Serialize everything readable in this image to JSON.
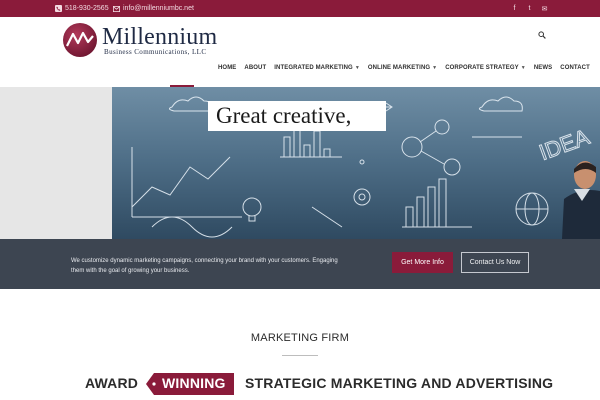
{
  "topbar": {
    "phone": "518-930-2565",
    "email": "info@millenniumbc.net",
    "social": [
      {
        "icon": "facebook-icon",
        "glyph": "f"
      },
      {
        "icon": "twitter-icon",
        "glyph": "t"
      },
      {
        "icon": "mail-icon",
        "glyph": "✉"
      }
    ]
  },
  "brand": {
    "name": "Millennium",
    "subtitle": "Business Communications, LLC",
    "accent": "#8a1b3a",
    "navy": "#1f2a44"
  },
  "nav": {
    "items": [
      {
        "label": "HOME",
        "dropdown": false
      },
      {
        "label": "ABOUT",
        "dropdown": false
      },
      {
        "label": "INTEGRATED MARKETING",
        "dropdown": true
      },
      {
        "label": "ONLINE MARKETING",
        "dropdown": true
      },
      {
        "label": "CORPORATE STRATEGY",
        "dropdown": true
      },
      {
        "label": "NEWS",
        "dropdown": false
      },
      {
        "label": "CONTACT",
        "dropdown": false
      }
    ],
    "caret": "▼"
  },
  "hero": {
    "headline": "Great creative,"
  },
  "band": {
    "text": "We customize dynamic marketing campaigns, connecting your brand with your customers. Engaging them with the goal of growing your business.",
    "primary_button": "Get More Info",
    "secondary_button": "Contact Us Now",
    "background": "#3d4551"
  },
  "section": {
    "title": "MARKETING FIRM",
    "tagline_left": "AWARD",
    "tagline_highlight": "WINNING",
    "tagline_right": "STRATEGIC MARKETING AND ADVERTISING"
  }
}
